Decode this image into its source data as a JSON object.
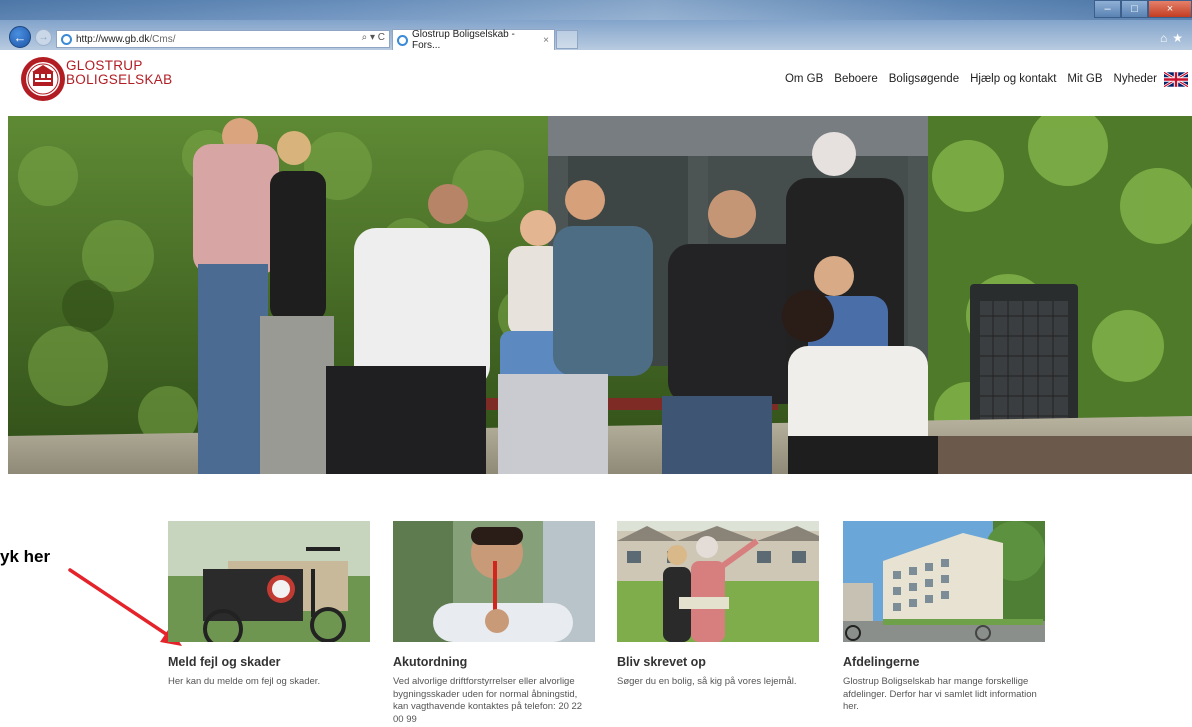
{
  "browser": {
    "url_host": "http://www.gb.dk",
    "url_path": "/Cms/",
    "address_tools": "⌕ ▾ C",
    "tab_title": "Glostrup Boligselskab - Fors...",
    "tab_close": "×",
    "win_minimize": "–",
    "win_restore": "□",
    "win_close": "×",
    "toolbar_icons": "⌂★"
  },
  "site": {
    "logo_line1": "GLOSTRUP",
    "logo_line2": "BOLIGSELSKAB",
    "brand_color": "#b21d24",
    "nav": [
      "Om GB",
      "Beboere",
      "Boligsøgende",
      "Hjælp og kontakt",
      "Mit GB",
      "Nyheder"
    ]
  },
  "annotation": {
    "text": "yk her",
    "arrow_color": "#e4232a"
  },
  "cards": [
    {
      "title": "Meld fejl og skader",
      "text": "Her kan du melde om fejl og skader."
    },
    {
      "title": "Akutordning",
      "text": "Ved alvorlige driftforstyrrelser eller alvorlige bygningsskader uden for normal åbningstid, kan vagthavende kontaktes på telefon: 20 22 00 99"
    },
    {
      "title": "Bliv skrevet op",
      "text": "Søger du en bolig, så kig på vores lejemål."
    },
    {
      "title": "Afdelingerne",
      "text": "Glostrup Boligselskab har mange forskellige afdelinger. Derfor har vi samlet lidt information her."
    }
  ]
}
